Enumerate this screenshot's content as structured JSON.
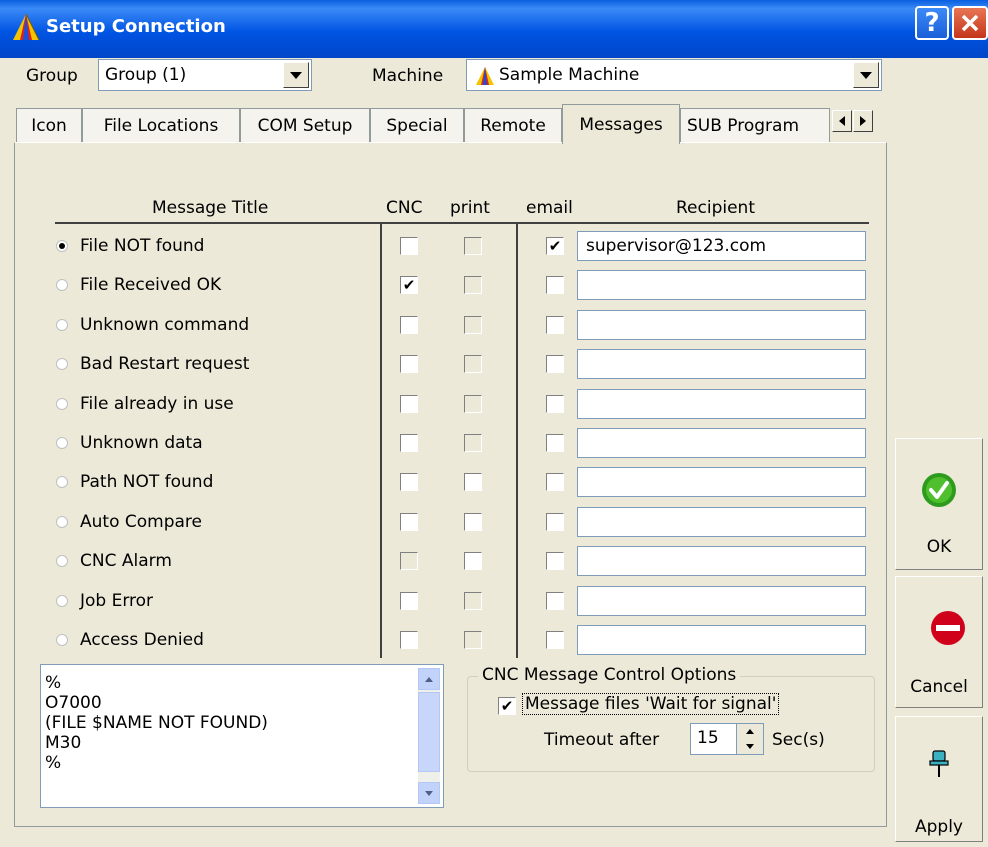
{
  "window": {
    "title": "Setup Connection",
    "help": "?"
  },
  "group": {
    "label": "Group",
    "value": "Group (1)"
  },
  "machine": {
    "label": "Machine",
    "value": "Sample Machine"
  },
  "tabs": [
    {
      "label": "Icon"
    },
    {
      "label": "File Locations"
    },
    {
      "label": "COM Setup"
    },
    {
      "label": "Special"
    },
    {
      "label": "Remote"
    },
    {
      "label": "Messages",
      "active": true
    },
    {
      "label": "SUB Program"
    }
  ],
  "table": {
    "headers": {
      "title": "Message Title",
      "cnc": "CNC",
      "print": "print",
      "email": "email",
      "recipient": "Recipient"
    },
    "rows": [
      {
        "title": "File NOT found",
        "selected": true,
        "cnc": false,
        "cnc_enabled": true,
        "print": false,
        "print_enabled": false,
        "email": true,
        "recipient": "supervisor@123.com"
      },
      {
        "title": "File Received OK",
        "selected": false,
        "cnc": true,
        "cnc_enabled": true,
        "print": false,
        "print_enabled": false,
        "email": false,
        "recipient": ""
      },
      {
        "title": "Unknown command",
        "selected": false,
        "cnc": false,
        "cnc_enabled": true,
        "print": false,
        "print_enabled": false,
        "email": false,
        "recipient": ""
      },
      {
        "title": "Bad Restart request",
        "selected": false,
        "cnc": false,
        "cnc_enabled": true,
        "print": false,
        "print_enabled": false,
        "email": false,
        "recipient": ""
      },
      {
        "title": "File already in use",
        "selected": false,
        "cnc": false,
        "cnc_enabled": true,
        "print": false,
        "print_enabled": false,
        "email": false,
        "recipient": ""
      },
      {
        "title": "Unknown data",
        "selected": false,
        "cnc": false,
        "cnc_enabled": true,
        "print": false,
        "print_enabled": false,
        "email": false,
        "recipient": ""
      },
      {
        "title": "Path NOT found",
        "selected": false,
        "cnc": false,
        "cnc_enabled": true,
        "print": false,
        "print_enabled": true,
        "email": false,
        "recipient": ""
      },
      {
        "title": "Auto Compare",
        "selected": false,
        "cnc": false,
        "cnc_enabled": true,
        "print": false,
        "print_enabled": true,
        "email": false,
        "recipient": ""
      },
      {
        "title": "CNC Alarm",
        "selected": false,
        "cnc": false,
        "cnc_enabled": false,
        "print": false,
        "print_enabled": true,
        "email": false,
        "recipient": ""
      },
      {
        "title": "Job Error",
        "selected": false,
        "cnc": false,
        "cnc_enabled": true,
        "print": false,
        "print_enabled": false,
        "email": false,
        "recipient": ""
      },
      {
        "title": "Access Denied",
        "selected": false,
        "cnc": false,
        "cnc_enabled": true,
        "print": false,
        "print_enabled": false,
        "email": false,
        "recipient": ""
      }
    ]
  },
  "memo": {
    "lines": [
      "%",
      "O7000",
      "(FILE $NAME NOT FOUND)",
      "M30",
      "%"
    ]
  },
  "options": {
    "title": "CNC Message Control Options",
    "wait_label": "Message files 'Wait for signal'",
    "wait_checked": true,
    "timeout_label": "Timeout after",
    "timeout_value": "15",
    "timeout_unit": "Sec(s)"
  },
  "buttons": {
    "ok": "OK",
    "cancel": "Cancel",
    "apply": "Apply"
  },
  "colors": {
    "titlebar": "#0054E3",
    "ok_icon": "#2E9B1E",
    "cancel_icon": "#D0021B",
    "face": "#ECE9D8"
  }
}
